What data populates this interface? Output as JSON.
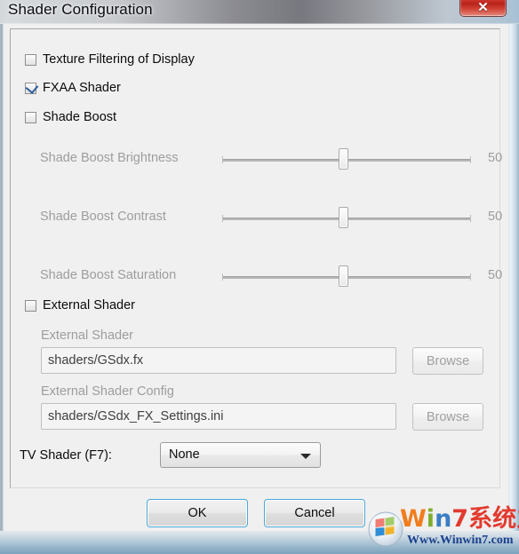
{
  "window": {
    "title": "Shader Configuration",
    "close_glyph": "✕",
    "close_icon_name": "close-icon"
  },
  "checkboxes": [
    {
      "label": "Texture Filtering of Display",
      "checked": false,
      "enabled": true
    },
    {
      "label": "FXAA Shader",
      "checked": true,
      "enabled": true
    },
    {
      "label": "Shade Boost",
      "checked": false,
      "enabled": true
    }
  ],
  "sliders": [
    {
      "label": "Shade Boost Brightness",
      "value": "50",
      "percent": 50,
      "enabled": false
    },
    {
      "label": "Shade Boost Contrast",
      "value": "50",
      "percent": 50,
      "enabled": false
    },
    {
      "label": "Shade Boost Saturation",
      "value": "50",
      "percent": 50,
      "enabled": false
    }
  ],
  "external_shader": {
    "checkbox_label": "External Shader",
    "checked": false,
    "shader_field_label": "External Shader",
    "shader_field_value": "shaders/GSdx.fx",
    "shader_browse_label": "Browse",
    "config_field_label": "External Shader Config",
    "config_field_value": "shaders/GSdx_FX_Settings.ini",
    "config_browse_label": "Browse"
  },
  "tv_shader": {
    "label": "TV Shader (F7):",
    "selected": "None"
  },
  "buttons": {
    "ok": "OK",
    "cancel": "Cancel"
  },
  "watermark": {
    "line1_w": "W",
    "line1_i": "i",
    "line1_n": "n",
    "line1_seven": "7",
    "line1_cn": "系统之家",
    "line2": "Www.Winwin7.com"
  },
  "colors": {
    "accent_blue": "#4aa8d8",
    "close_red": "#c73127",
    "check_blue": "#2c5d9b",
    "disabled_text": "#9d9d9d",
    "dialog_bg": "#f0f0f0"
  }
}
